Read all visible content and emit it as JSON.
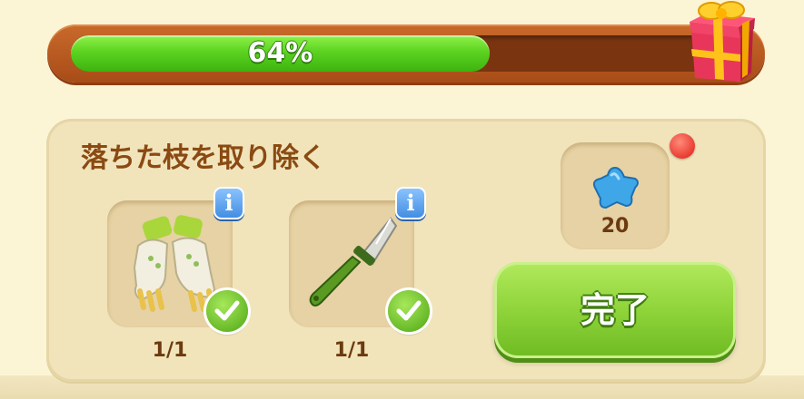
{
  "progress": {
    "percent_label": "64%",
    "value": 0.64
  },
  "icons": {
    "gift": "gift-box-icon",
    "info": "info-icon",
    "check": "check-icon",
    "gem": "blue-star-gem-icon"
  },
  "task": {
    "title": "落ちた枝を取り除く",
    "items": [
      {
        "name": "gloves",
        "count": "1/1"
      },
      {
        "name": "knife",
        "count": "1/1"
      }
    ],
    "reward": {
      "count": "20"
    },
    "done_label": "完了"
  },
  "colors": {
    "accent_green": "#8fd43a",
    "frame_orange": "#b85a1f",
    "reward_blue": "#3fa6e8",
    "notification_red": "#e01a12"
  }
}
